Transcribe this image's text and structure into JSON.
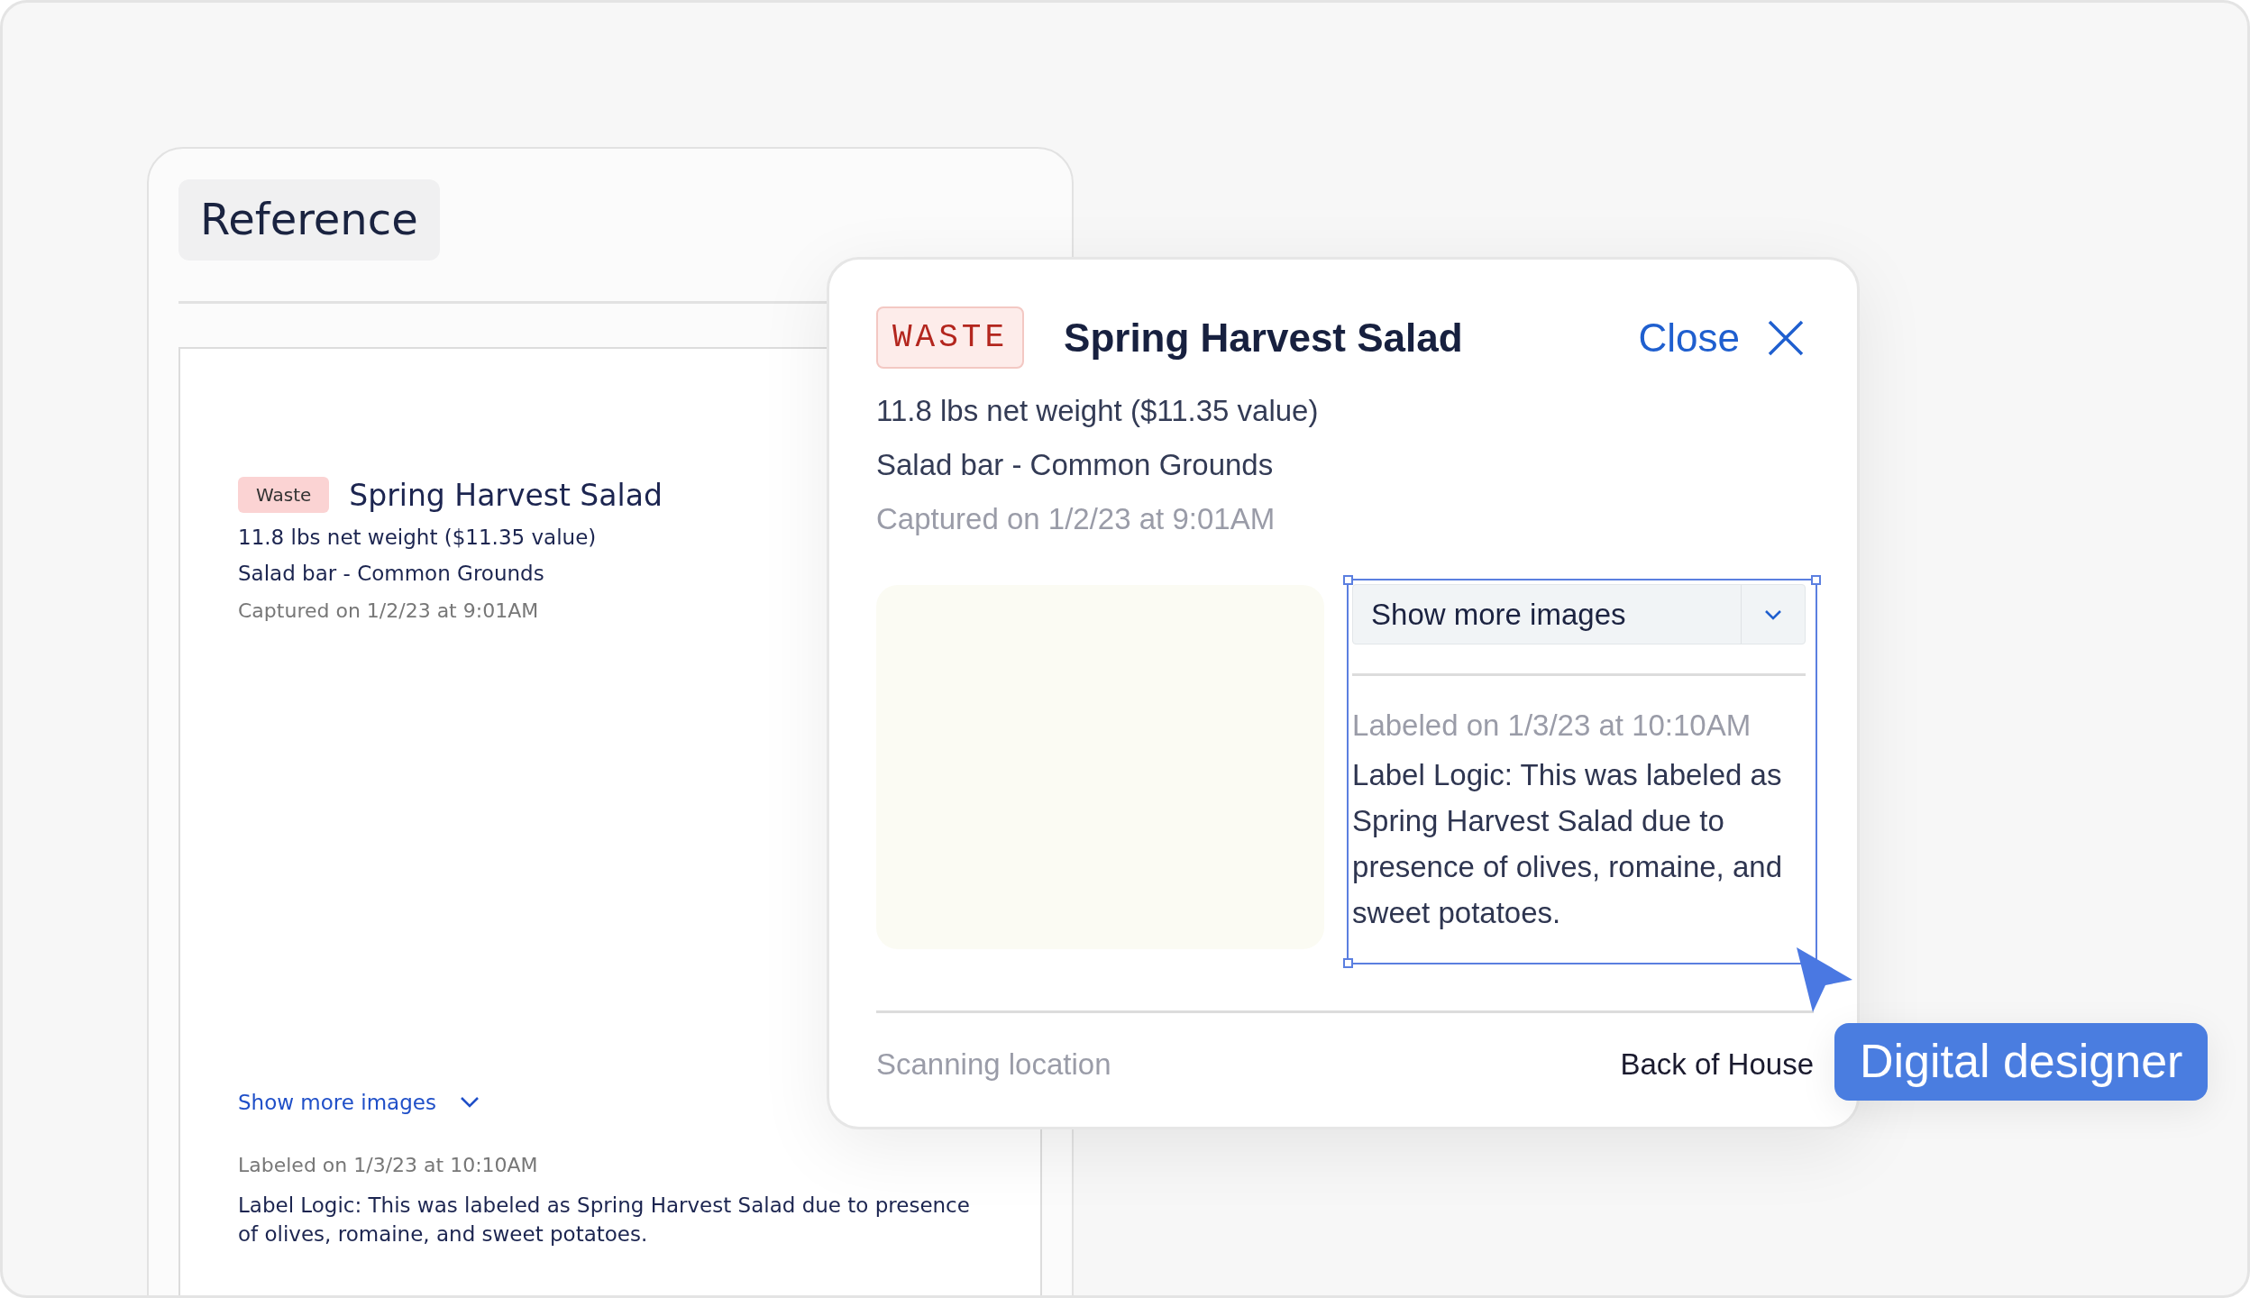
{
  "reference": {
    "title": "Reference",
    "record": {
      "tag": "Waste",
      "name": "Spring Harvest Salad",
      "weight": "11.8 lbs net weight ($11.35 value)",
      "location": "Salad bar - Common Grounds",
      "captured": "Captured on 1/2/23 at 9:01AM",
      "show_more": "Show more images",
      "labeled": "Labeled on 1/3/23 at 10:10AM",
      "logic": "Label Logic: This was labeled as Spring Harvest Salad due to presence of olives, romaine, and sweet potatoes."
    }
  },
  "detail": {
    "tag": "WASTE",
    "name": "Spring Harvest Salad",
    "close": "Close",
    "weight": "11.8 lbs net weight ($11.35 value)",
    "location": "Salad bar - Common Grounds",
    "captured": "Captured on 1/2/23 at 9:01AM",
    "label_panel": {
      "selected": true,
      "dropdown": "Show more images",
      "labeled": "Labeled on 1/3/23 at 10:10AM",
      "logic": "Label Logic: This was labeled as Spring Harvest Salad due to presence of olives, romaine, and sweet potatoes."
    },
    "footer": {
      "label": "Scanning location",
      "value": "Back of House"
    }
  },
  "cursor": {
    "name": "Digital designer"
  }
}
